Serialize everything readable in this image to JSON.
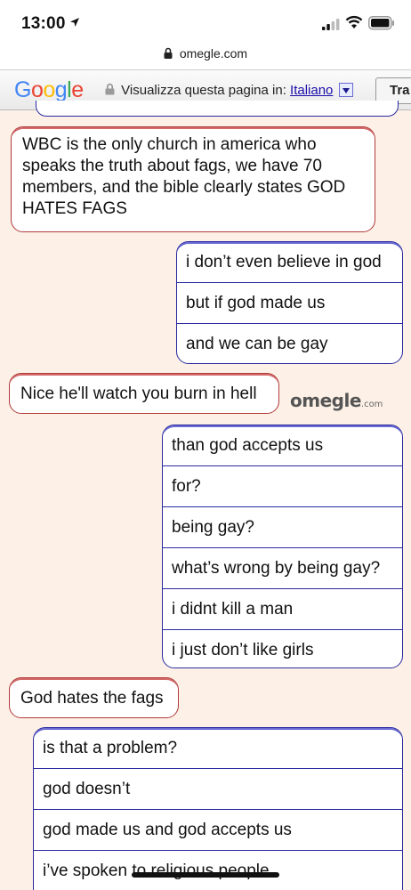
{
  "status_bar": {
    "time": "13:00"
  },
  "url_bar": {
    "domain": "omegle.com"
  },
  "translate_bar": {
    "logo": "Google",
    "prompt": "Visualizza questa pagina in:",
    "language": "Italiano",
    "button": "Tra"
  },
  "watermark": {
    "name": "omegle",
    "suffix": ".com"
  },
  "messages": {
    "m1": "WBC is the only church in america who speaks the truth about fags, we have 70 members, and the bible clearly states GOD HATES FAGS",
    "y1": [
      "i don’t even believe in god",
      "but if god made us",
      "and we can be gay"
    ],
    "m2": "Nice he'll watch you burn in hell",
    "y2": [
      "than god accepts us",
      "for?",
      "being gay?",
      "what’s wrong by being gay?",
      "i didnt kill a man",
      "i just don’t like girls"
    ],
    "m3": "God hates the fags",
    "y3": [
      "is that a problem?",
      "god doesn’t",
      "god made us and god accepts us",
      "i’ve spoken to religious people"
    ]
  },
  "colors": {
    "stranger_border": "#b03a3a",
    "you_border": "#2a2aa0",
    "background": "#fdf1e7"
  }
}
